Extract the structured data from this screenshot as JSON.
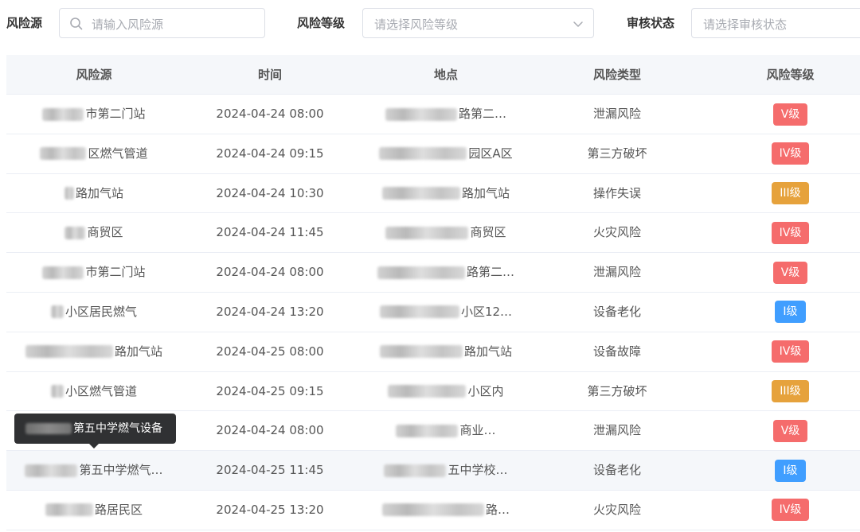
{
  "filters": {
    "source": {
      "label": "风险源",
      "placeholder": "请输入风险源"
    },
    "level": {
      "label": "风险等级",
      "placeholder": "请选择风险等级"
    },
    "status": {
      "label": "审核状态",
      "placeholder": "请选择审核状态"
    }
  },
  "table": {
    "headers": [
      "风险源",
      "时间",
      "地点",
      "风险类型",
      "风险等级"
    ],
    "rows": [
      {
        "source": "市第二门站",
        "time": "2024-04-24 08:00",
        "location": "路第二…",
        "type": "泄漏风险",
        "level": "V级",
        "color": "#f56c6c"
      },
      {
        "source": "区燃气管道",
        "time": "2024-04-24 09:15",
        "location": "园区A区",
        "type": "第三方破坏",
        "level": "IV级",
        "color": "#f56c6c"
      },
      {
        "source": "路加气站",
        "time": "2024-04-24 10:30",
        "location": "路加气站",
        "type": "操作失误",
        "level": "III级",
        "color": "#e6a23c"
      },
      {
        "source": "商贸区",
        "time": "2024-04-24 11:45",
        "location": "商贸区",
        "type": "火灾风险",
        "level": "IV级",
        "color": "#f56c6c"
      },
      {
        "source": "市第二门站",
        "time": "2024-04-24 08:00",
        "location": "路第二…",
        "type": "泄漏风险",
        "level": "V级",
        "color": "#f56c6c"
      },
      {
        "source": "小区居民燃气",
        "time": "2024-04-24 13:20",
        "location": "小区12…",
        "type": "设备老化",
        "level": "I级",
        "color": "#409eff"
      },
      {
        "source": "路加气站",
        "time": "2024-04-25 08:00",
        "location": "路加气站",
        "type": "设备故障",
        "level": "IV级",
        "color": "#f56c6c"
      },
      {
        "source": "小区燃气管道",
        "time": "2024-04-25 09:15",
        "location": "小区内",
        "type": "第三方破坏",
        "level": "III级",
        "color": "#e6a23c"
      },
      {
        "source": "",
        "time": "2024-04-24 08:00",
        "location": "商业…",
        "type": "泄漏风险",
        "level": "V级",
        "color": "#f56c6c"
      },
      {
        "source": "第五中学燃气…",
        "time": "2024-04-25 11:45",
        "location": "五中学校…",
        "type": "设备老化",
        "level": "I级",
        "color": "#409eff"
      },
      {
        "source": "路居民区",
        "time": "2024-04-25 13:20",
        "location": "路…",
        "type": "火灾风险",
        "level": "IV级",
        "color": "#f56c6c"
      }
    ]
  },
  "tooltip": {
    "text": "第五中学燃气设备"
  }
}
